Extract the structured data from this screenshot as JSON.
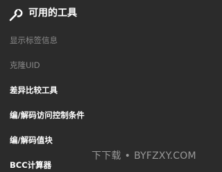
{
  "header": {
    "icon": "wrench-icon",
    "title": "可用的工具"
  },
  "items": [
    {
      "label": "显示标签信息",
      "enabled": false
    },
    {
      "label": "克隆UID",
      "enabled": false
    },
    {
      "label": "差异比较工具",
      "enabled": true
    },
    {
      "label": "编/解码访问控制条件",
      "enabled": true
    },
    {
      "label": "编/解码值块",
      "enabled": true
    },
    {
      "label": "BCC计算器",
      "enabled": true
    }
  ],
  "watermark": {
    "prefix": "下下载",
    "separator": "•",
    "site": "BYFZXY.COM"
  }
}
